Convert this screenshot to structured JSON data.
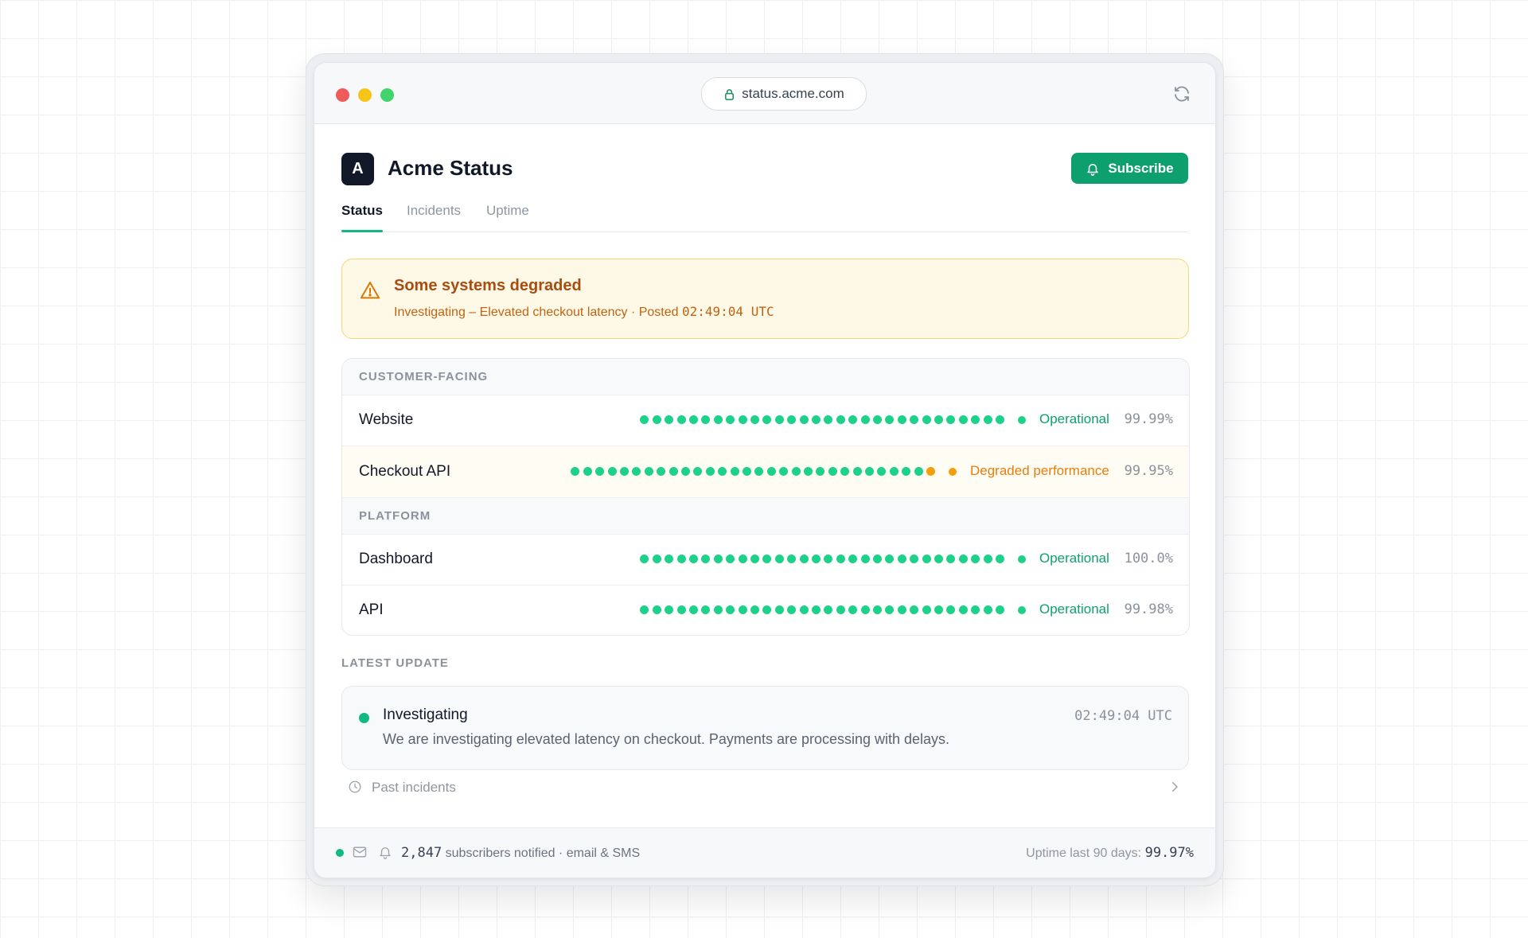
{
  "browser": {
    "url": "status.acme.com"
  },
  "header": {
    "logo_letter": "A",
    "brand": "Acme Status",
    "subscribe_label": "Subscribe"
  },
  "tabs": [
    {
      "label": "Status",
      "active": true
    },
    {
      "label": "Incidents",
      "active": false
    },
    {
      "label": "Uptime",
      "active": false
    }
  ],
  "banner": {
    "title": "Some systems degraded",
    "subtitle_prefix": "Investigating – Elevated checkout latency · Posted",
    "time": "02:49:04 UTC",
    "icon": "warning-triangle-icon",
    "color": "#a74d12"
  },
  "groups": [
    {
      "label": "CUSTOMER-FACING",
      "components": [
        {
          "name": "Website",
          "status": "Operational",
          "uptime": "99.99%",
          "bars": 30,
          "degraded_bars": 0
        },
        {
          "name": "Checkout API",
          "status": "Degraded performance",
          "uptime": "99.95%",
          "bars": 30,
          "degraded_bars": 1
        }
      ]
    },
    {
      "label": "PLATFORM",
      "components": [
        {
          "name": "Dashboard",
          "status": "Operational",
          "uptime": "100.0%",
          "bars": 30,
          "degraded_bars": 0
        },
        {
          "name": "API",
          "status": "Operational",
          "uptime": "99.98%",
          "bars": 30,
          "degraded_bars": 0
        }
      ]
    }
  ],
  "colors": {
    "operational": "#0e9f6e",
    "bar_operational": "#1dd18a",
    "degraded": "#ea7d0c",
    "bar_degraded": "#f59e0b",
    "accent": "#0e9f6e"
  },
  "latest": {
    "section_label": "LATEST UPDATE",
    "title": "Investigating",
    "time": "02:49:04 UTC",
    "body": "We are investigating elevated latency on checkout. Payments are processing with delays."
  },
  "past_incidents_label": "Past incidents",
  "footer": {
    "subscribers_count": "2,847",
    "subscribers_text": "subscribers notified · email & SMS",
    "uptime_label": "Uptime last 90 days:",
    "uptime_value": "99.97%"
  }
}
